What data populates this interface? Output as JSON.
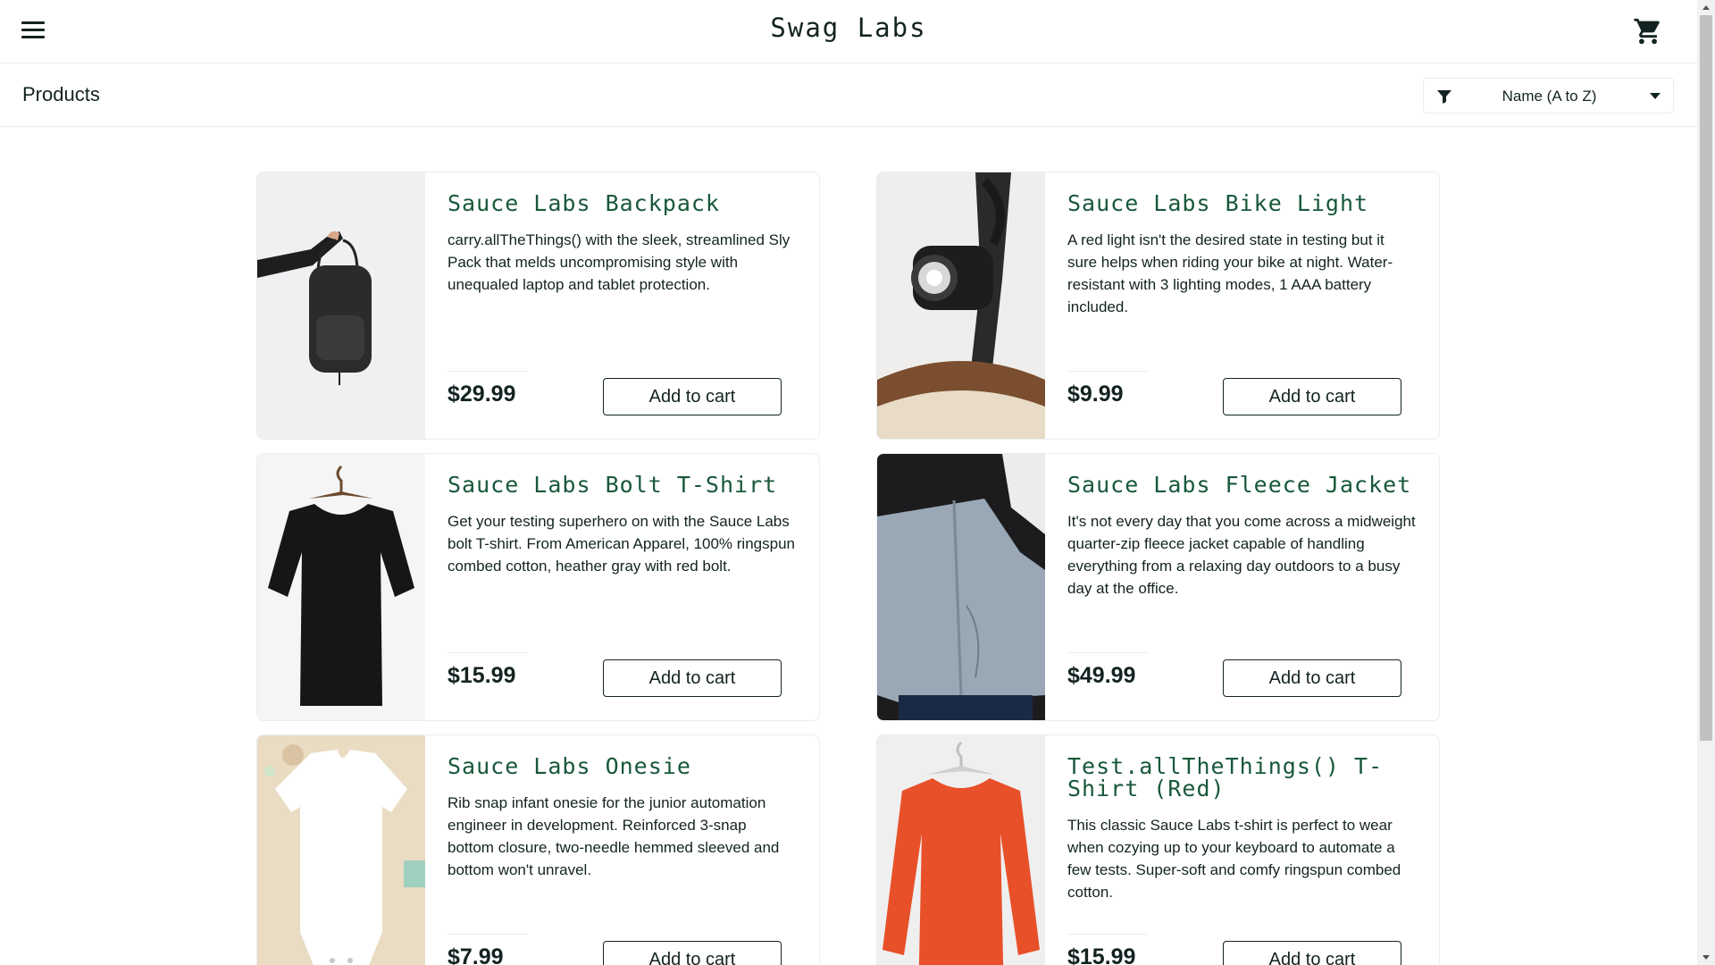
{
  "header": {
    "app_title": "Swag Labs",
    "menu_icon": "hamburger-menu-icon",
    "cart_icon": "shopping-cart-icon"
  },
  "subheader": {
    "title": "Products",
    "sort": {
      "selected": "Name (A to Z)",
      "icon": "filter-icon"
    }
  },
  "inventory": {
    "items": [
      {
        "name": "Sauce Labs Backpack",
        "description": "carry.allTheThings() with the sleek, streamlined Sly Pack that melds uncompromising style with unequaled laptop and tablet protection.",
        "price": "$29.99",
        "button": "Add to cart"
      },
      {
        "name": "Sauce Labs Bike Light",
        "description": "A red light isn't the desired state in testing but it sure helps when riding your bike at night. Water-resistant with 3 lighting modes, 1 AAA battery included.",
        "price": "$9.99",
        "button": "Add to cart"
      },
      {
        "name": "Sauce Labs Bolt T-Shirt",
        "description": "Get your testing superhero on with the Sauce Labs bolt T-shirt. From American Apparel, 100% ringspun combed cotton, heather gray with red bolt.",
        "price": "$15.99",
        "button": "Add to cart"
      },
      {
        "name": "Sauce Labs Fleece Jacket",
        "description": "It's not every day that you come across a midweight quarter-zip fleece jacket capable of handling everything from a relaxing day outdoors to a busy day at the office.",
        "price": "$49.99",
        "button": "Add to cart"
      },
      {
        "name": "Sauce Labs Onesie",
        "description": "Rib snap infant onesie for the junior automation engineer in development. Reinforced 3-snap bottom closure, two-needle hemmed sleeved and bottom won't unravel.",
        "price": "$7.99",
        "button": "Add to cart"
      },
      {
        "name": "Test.allTheThings() T-Shirt (Red)",
        "description": "This classic Sauce Labs t-shirt is perfect to wear when cozying up to your keyboard to automate a few tests. Super-soft and comfy ringspun combed cotton.",
        "price": "$15.99",
        "button": "Add to cart"
      }
    ]
  },
  "colors": {
    "item_name": "#18583a",
    "text": "#132322",
    "border": "#ededef"
  }
}
